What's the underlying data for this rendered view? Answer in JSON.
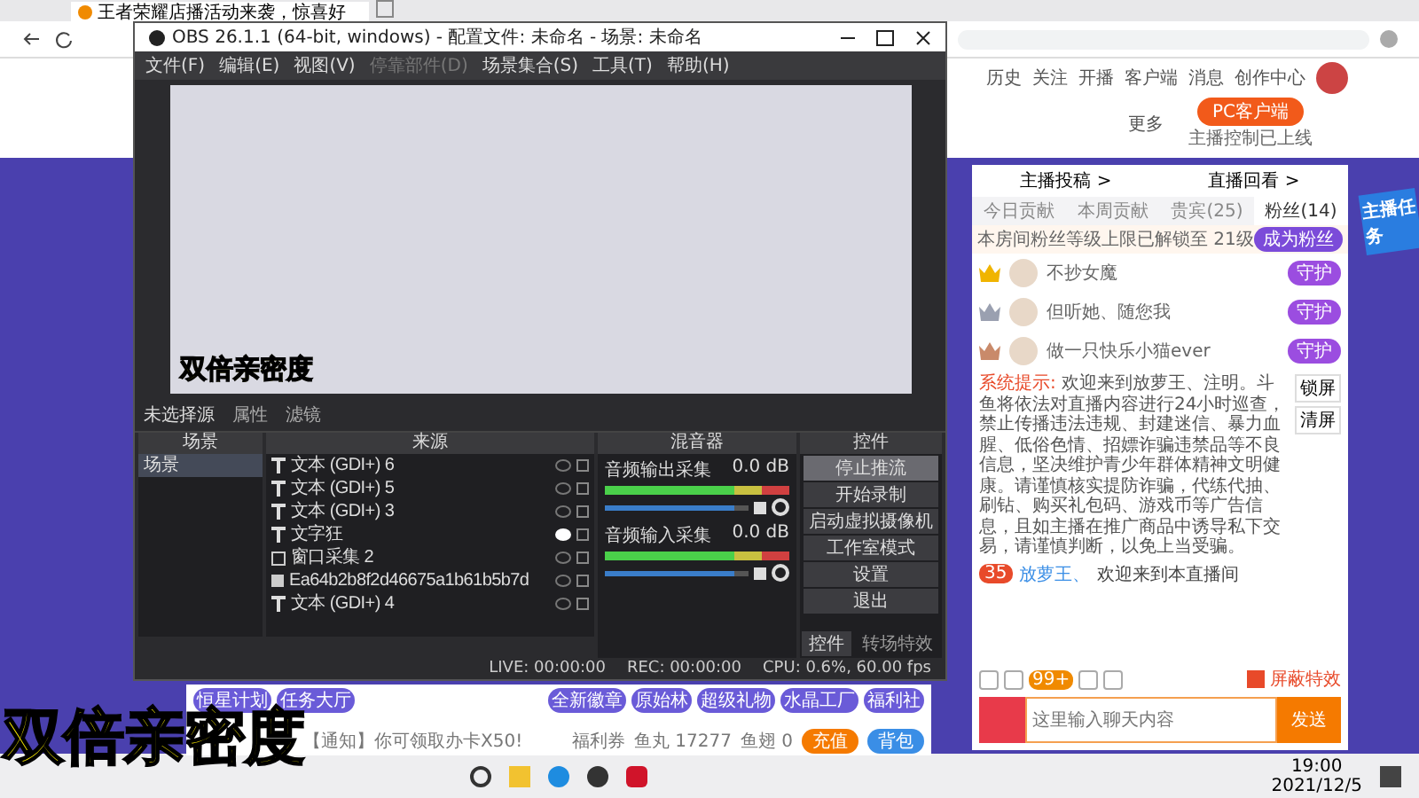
{
  "browser": {
    "tab_title": "王者荣耀店播活动来袭，惊喜好"
  },
  "site_header": {
    "nav": [
      "历史",
      "关注",
      "开播",
      "客户端",
      "消息",
      "创作中心"
    ],
    "more": "更多",
    "client_button": "PC客户端",
    "client_note": "主播控制已上线"
  },
  "obs": {
    "title": "OBS 26.1.1 (64-bit, windows) - 配置文件: 未命名 - 场景: 未命名",
    "menu": [
      {
        "label": "文件(F)",
        "disabled": false
      },
      {
        "label": "编辑(E)",
        "disabled": false
      },
      {
        "label": "视图(V)",
        "disabled": false
      },
      {
        "label": "停靠部件(D)",
        "disabled": true
      },
      {
        "label": "场景集合(S)",
        "disabled": false
      },
      {
        "label": "工具(T)",
        "disabled": false
      },
      {
        "label": "帮助(H)",
        "disabled": false
      }
    ],
    "preview_caption": "双倍亲密度",
    "source_status": "未选择源",
    "properties": "属性",
    "filters": "滤镜",
    "docks": {
      "scenes": "场景",
      "sources": "来源",
      "mixer": "混音器",
      "controls": "控件"
    },
    "scenes": [
      {
        "name": "场景",
        "selected": true
      }
    ],
    "sources": [
      {
        "kind": "text",
        "name": "文本 (GDI+) 6",
        "visible": false
      },
      {
        "kind": "text",
        "name": "文本 (GDI+) 5",
        "visible": false
      },
      {
        "kind": "text",
        "name": "文本 (GDI+) 3",
        "visible": false
      },
      {
        "kind": "text",
        "name": "文字狂",
        "visible": true
      },
      {
        "kind": "window",
        "name": "窗口采集 2",
        "visible": false
      },
      {
        "kind": "image",
        "name": "Ea64b2b8f2d46675a1b61b5b7d",
        "visible": false
      },
      {
        "kind": "text",
        "name": "文本 (GDI+) 4",
        "visible": false
      }
    ],
    "channels": [
      {
        "name": "音频输出采集",
        "reading": "0.0 dB",
        "level": 0.9
      },
      {
        "name": "音频输入采集",
        "reading": "0.0 dB",
        "level": 0.9
      }
    ],
    "controls": [
      {
        "label": "停止推流",
        "active": true
      },
      {
        "label": "开始录制",
        "active": false
      },
      {
        "label": "启动虚拟摄像机",
        "active": false
      },
      {
        "label": "工作室模式",
        "active": false
      },
      {
        "label": "设置",
        "active": false
      },
      {
        "label": "退出",
        "active": false
      }
    ],
    "bottom_tabs": [
      {
        "label": "控件",
        "selected": true
      },
      {
        "label": "转场特效",
        "selected": false
      }
    ],
    "status": [
      "LIVE: 00:00:00",
      "REC: 00:00:00",
      "CPU: 0.6%, 60.00 fps"
    ]
  },
  "room_panel": {
    "links": [
      "主播投稿 >",
      "直播回看 >"
    ],
    "tabs": [
      {
        "label": "今日贡献",
        "selected": false
      },
      {
        "label": "本周贡献",
        "selected": false
      },
      {
        "label": "贵宾(25)",
        "selected": false
      },
      {
        "label": "粉丝(14)",
        "selected": true
      }
    ],
    "unlock_note": "本房间粉丝等级上限已解锁至 21级",
    "join_button": "成为粉丝",
    "fans": [
      {
        "name": "不抄女魔",
        "color": "#f0b400",
        "badge": "守护"
      },
      {
        "name": "但听她、随您我",
        "color": "#9aa0b0",
        "badge": "守护"
      },
      {
        "name": "做一只快乐小猫ever",
        "color": "#c98a6a",
        "badge": "守护"
      }
    ],
    "notice_label": "系统提示:",
    "notice": "欢迎来到放萝王、注明。斗鱼将依法对直播内容进行24小时巡查，禁止传播违法违规、封建迷信、暴力血腥、低俗色情、招嫖诈骗违禁品等不良信息，坚决维护青少年群体精神文明健康。请谨慎核实提防诈骗，代练代抽、刷钻、购买礼包码、游戏币等广告信息，且如主播在推广商品中诱导私下交易，请谨慎判断，以免上当受骗。",
    "notice_buttons": [
      "锁屏",
      "清屏"
    ],
    "chat": [
      {
        "level": "35",
        "user": "放萝王、",
        "text": "欢迎来到本直播间"
      }
    ],
    "badge_count": "99+",
    "effects_toggle": {
      "label": "屏蔽特效",
      "checked": true
    },
    "input_placeholder": "这里输入聊天内容",
    "send_button": "发送"
  },
  "task_banner": "主播任务",
  "gift_bar": {
    "gifts": [
      "恒星计划",
      "任务大厅",
      "全新徽章",
      "原始林",
      "超级礼物",
      "水晶工厂",
      "福利社"
    ],
    "notice": "【通知】你可领取办卡X50!",
    "coupons": "福利券",
    "fish_balls": "鱼丸 17277",
    "fish_fins": "鱼翅 0",
    "recharge": "充值",
    "backpack": "背包"
  },
  "overlay_caption": "双倍亲密度",
  "taskbar": {
    "time": "19:00",
    "date": "2021/12/5"
  }
}
